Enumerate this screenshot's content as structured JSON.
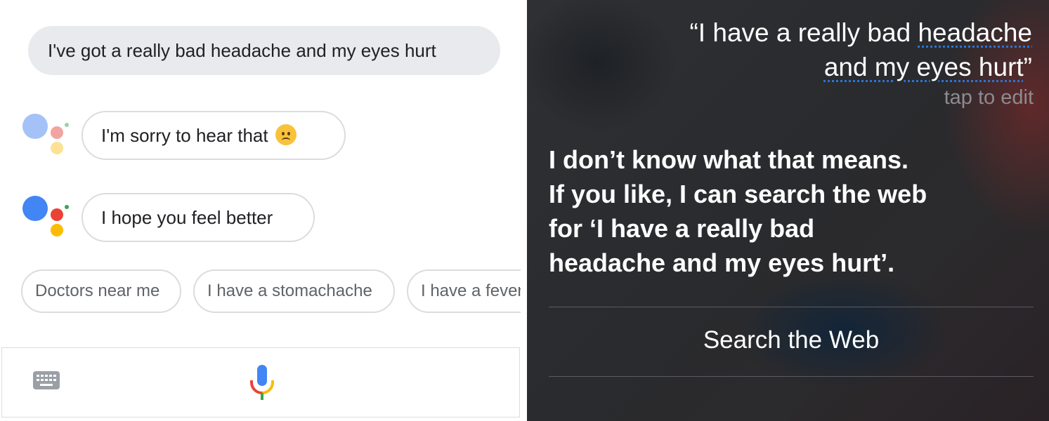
{
  "assistant": {
    "user_query": "I've got a really bad headache and my eyes hurt",
    "replies": [
      "I'm sorry to hear that",
      "I hope you feel better"
    ],
    "reply_emoji": "worried-face-emoji",
    "suggestion_chips": [
      "Doctors near me",
      "I have a stomachache",
      "I have a fever"
    ],
    "input_bar": {
      "keyboard_icon": "keyboard-icon",
      "mic_icon": "microphone-icon"
    },
    "logo_colors": [
      "#4285f4",
      "#ea4335",
      "#fbbc05",
      "#34a853"
    ]
  },
  "siri": {
    "quote_part1": "“I have a really bad ",
    "quote_underlined1": "headache",
    "quote_underlined2": "and my eyes hurt",
    "quote_end": "”",
    "tap_to_edit": "tap to edit",
    "answer_lines": [
      "I don’t know what that means.",
      "If you like, I can search the web",
      "for ‘I have a really bad",
      "headache and my eyes hurt’."
    ],
    "search_button": "Search the Web",
    "underline_color": "#2b74d6"
  }
}
